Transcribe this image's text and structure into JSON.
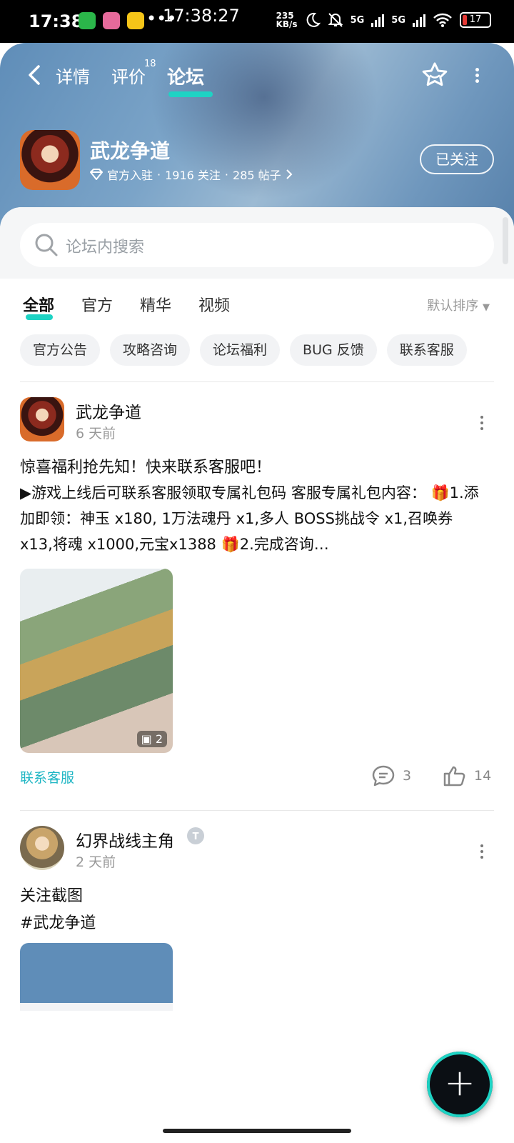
{
  "status_bar": {
    "time": "17:38",
    "clock_overlay": "17:38:27",
    "dots": "•••",
    "speed_value": "235",
    "speed_unit": "KB/s",
    "network_1": "5G",
    "network_2": "5G",
    "battery": "17"
  },
  "nav": {
    "tabs": [
      {
        "label": "详情"
      },
      {
        "label": "评价",
        "count": "18"
      },
      {
        "label": "论坛"
      }
    ]
  },
  "game": {
    "name": "武龙争道",
    "verified": "官方入驻",
    "followers": "1916 关注",
    "posts": "285 帖子",
    "sep": "·",
    "follow_label": "已关注"
  },
  "search": {
    "placeholder": "论坛内搜索"
  },
  "filter_tabs": [
    "全部",
    "官方",
    "精华",
    "视频"
  ],
  "sort_label": "默认排序",
  "chips": [
    "官方公告",
    "攻略咨询",
    "论坛福利",
    "BUG 反馈",
    "联系客服"
  ],
  "posts": [
    {
      "author": "武龙争道",
      "time": "6 天前",
      "title": "惊喜福利抢先知！快来联系客服吧！",
      "body": "▶游戏上线后可联系客服领取专属礼包码 客服专属礼包内容： 🎁1.添加即领：神玉 x180, 1万法魂丹 x1,多人 BOSS挑战令 x1,召唤券 x13,将魂 x1000,元宝x1388 🎁2.完成咨询…",
      "image_count": "2",
      "tag": "联系客服",
      "comments": "3",
      "likes": "14"
    },
    {
      "author": "幻界战线主角",
      "time": "2 天前",
      "title": "关注截图",
      "hashtag": "#武龙争道"
    }
  ],
  "colors": {
    "accent": "#1ed3c4",
    "link": "#1fb6c4"
  }
}
